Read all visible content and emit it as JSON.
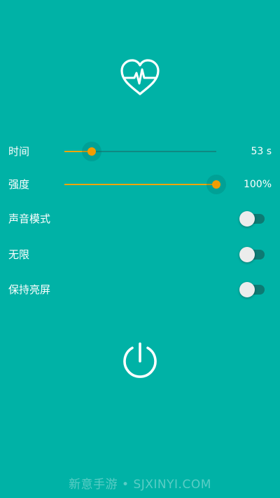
{
  "controls": {
    "time": {
      "label": "时间",
      "value_text": "53 s",
      "fraction": 0.18
    },
    "intensity": {
      "label": "强度",
      "value_text": "100%",
      "fraction": 1.0
    },
    "sound_mode": {
      "label": "声音模式",
      "on": false
    },
    "unlimited": {
      "label": "无限",
      "on": false
    },
    "keep_screen_on": {
      "label": "保持亮屏",
      "on": false
    }
  },
  "icons": {
    "logo": "heart-pulse-icon",
    "power": "power-icon"
  },
  "watermark": "新意手游 • SJXINYI.COM",
  "colors": {
    "background": "#00b2a6",
    "accent": "#f29d00",
    "track": "#0f8a82",
    "toggle_off_track": "#0d7a73",
    "foreground": "#ffffff"
  }
}
